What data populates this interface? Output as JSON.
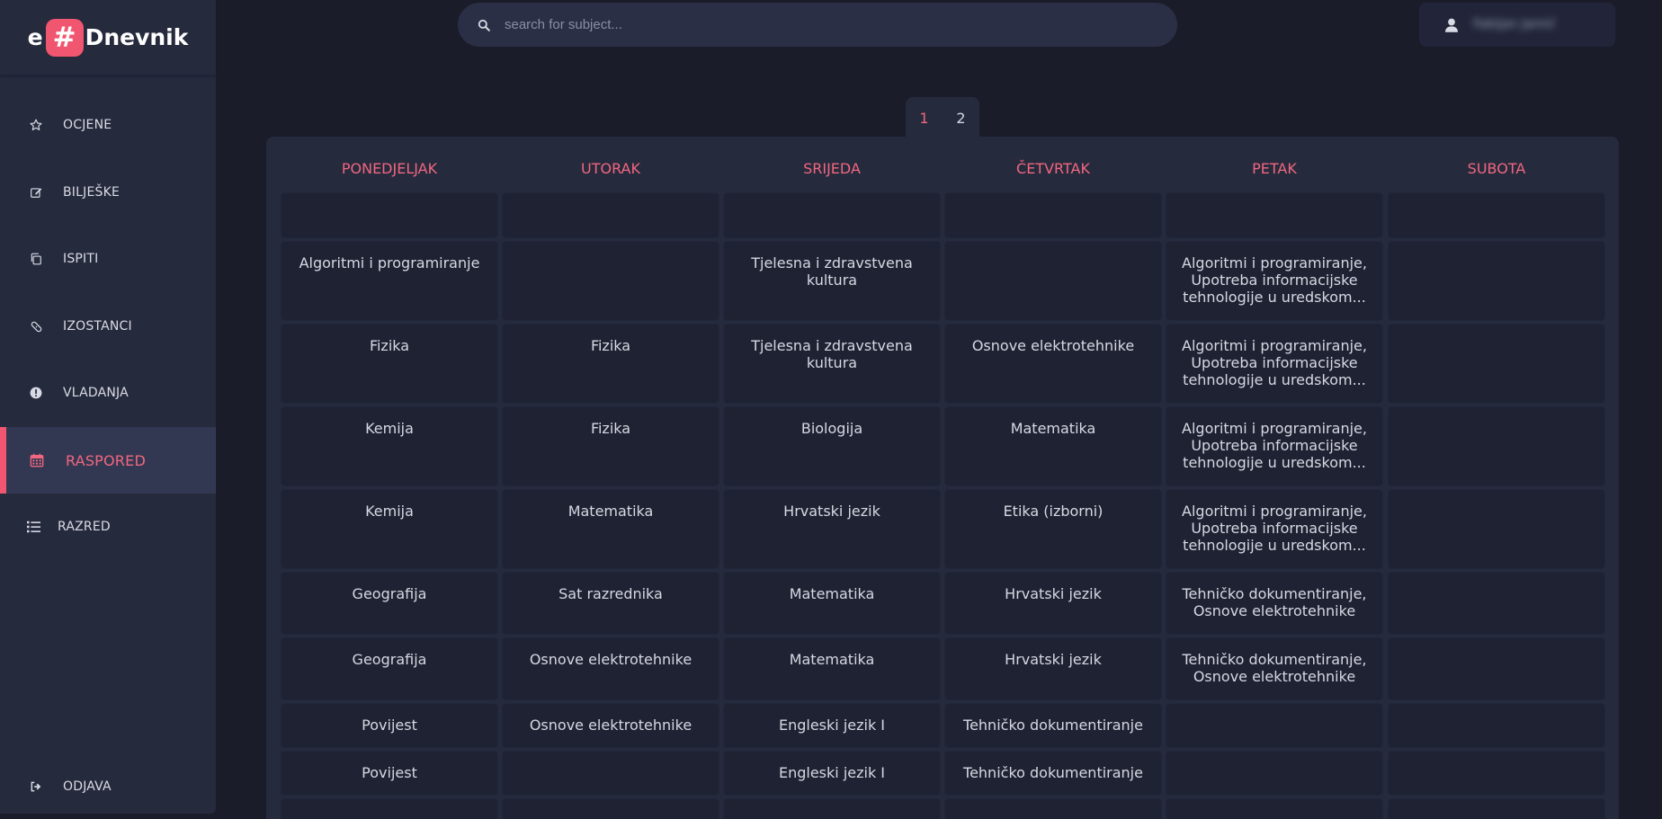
{
  "logo": {
    "left": "e",
    "mark": "#",
    "right": "Dnevnik"
  },
  "sidebar": {
    "items": [
      {
        "label": "OCJENE",
        "icon": "star-icon"
      },
      {
        "label": "BILJEŠKE",
        "icon": "edit-icon"
      },
      {
        "label": "ISPITI",
        "icon": "copy-icon"
      },
      {
        "label": "IZOSTANCI",
        "icon": "bandage-icon"
      },
      {
        "label": "VLADANJA",
        "icon": "exclamation-icon"
      },
      {
        "label": "RASPORED",
        "icon": "calendar-icon",
        "active": true
      },
      {
        "label": "RAZRED",
        "icon": "list-icon"
      }
    ],
    "logout": {
      "label": "ODJAVA",
      "icon": "sign-out-icon"
    }
  },
  "search": {
    "placeholder": "search for subject..."
  },
  "user": {
    "name": "Fabijan Jamić",
    "icon": "user-icon"
  },
  "week_tabs": [
    "1",
    "2"
  ],
  "active_week": "1",
  "timetable": {
    "days": [
      "PONEDJELJAK",
      "UTORAK",
      "SRIJEDA",
      "ČETVRTAK",
      "PETAK",
      "SUBOTA"
    ],
    "rows": [
      [
        "",
        "",
        "",
        "",
        "",
        ""
      ],
      [
        "Algoritmi i programiranje",
        "",
        "Tjelesna i zdravstvena kultura",
        "",
        "Algoritmi i programiranje, Upotreba informacijske tehnologije u uredskom...",
        ""
      ],
      [
        "Fizika",
        "Fizika",
        "Tjelesna i zdravstvena kultura",
        "Osnove elektrotehnike",
        "Algoritmi i programiranje, Upotreba informacijske tehnologije u uredskom...",
        ""
      ],
      [
        "Kemija",
        "Fizika",
        "Biologija",
        "Matematika",
        "Algoritmi i programiranje, Upotreba informacijske tehnologije u uredskom...",
        ""
      ],
      [
        "Kemija",
        "Matematika",
        "Hrvatski jezik",
        "Etika (izborni)",
        "Algoritmi i programiranje, Upotreba informacijske tehnologije u uredskom...",
        ""
      ],
      [
        "Geografija",
        "Sat razrednika",
        "Matematika",
        "Hrvatski jezik",
        "Tehničko dokumentiranje, Osnove elektrotehnike",
        ""
      ],
      [
        "Geografija",
        "Osnove elektrotehnike",
        "Matematika",
        "Hrvatski jezik",
        "Tehničko dokumentiranje, Osnove elektrotehnike",
        ""
      ],
      [
        "Povijest",
        "Osnove elektrotehnike",
        "Engleski jezik I",
        "Tehničko dokumentiranje",
        "",
        ""
      ],
      [
        "Povijest",
        "",
        "Engleski jezik I",
        "Tehničko dokumentiranje",
        "",
        ""
      ],
      [
        "",
        "",
        "",
        "",
        "",
        ""
      ]
    ]
  },
  "colors": {
    "accent": "#f0566f",
    "background": "#1b1c2a",
    "sidebar": "#262a3d"
  }
}
